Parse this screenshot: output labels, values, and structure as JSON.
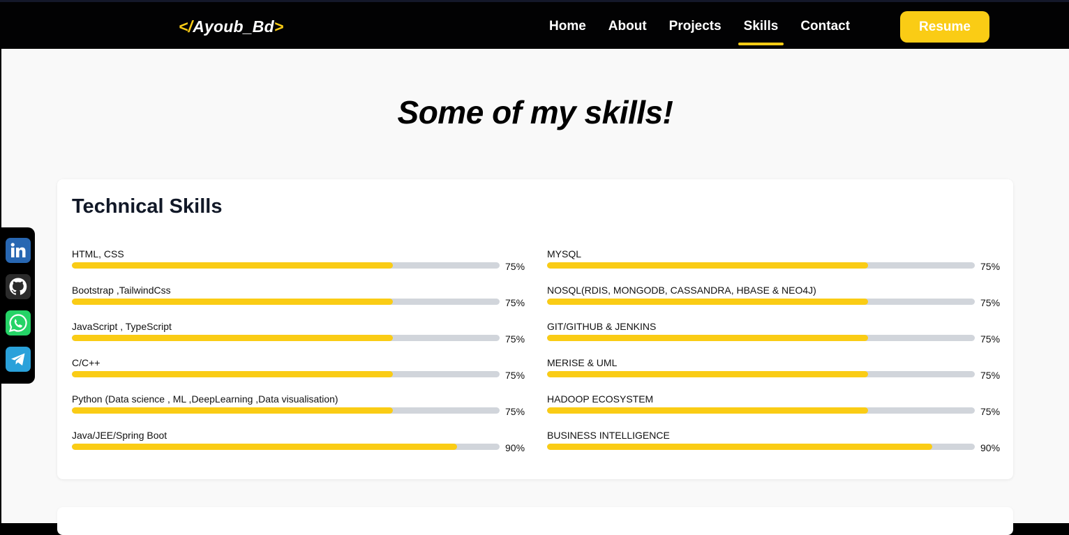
{
  "nav": {
    "logo_open": "</",
    "logo_name": "Ayoub_Bd",
    "logo_close": ">",
    "links": [
      "Home",
      "About",
      "Projects",
      "Skills",
      "Contact"
    ],
    "active": "Skills",
    "resume_label": "Resume"
  },
  "page": {
    "title": "Some of my skills!"
  },
  "technical": {
    "title": "Technical Skills",
    "left": [
      {
        "label": "HTML, CSS",
        "percent": 75,
        "percent_label": "75%"
      },
      {
        "label": "Bootstrap ,TailwindCss",
        "percent": 75,
        "percent_label": "75%"
      },
      {
        "label": "JavaScript , TypeScript",
        "percent": 75,
        "percent_label": "75%"
      },
      {
        "label": "C/C++",
        "percent": 75,
        "percent_label": "75%"
      },
      {
        "label": "Python (Data science , ML ,DeepLearning ,Data visualisation)",
        "percent": 75,
        "percent_label": "75%"
      },
      {
        "label": "Java/JEE/Spring Boot",
        "percent": 90,
        "percent_label": "90%"
      }
    ],
    "right": [
      {
        "label": "MYSQL",
        "percent": 75,
        "percent_label": "75%"
      },
      {
        "label": "NOSQL(RDIS, MONGODB, CASSANDRA, HBASE & NEO4J)",
        "percent": 75,
        "percent_label": "75%"
      },
      {
        "label": "GIT/GITHUB & JENKINS",
        "percent": 75,
        "percent_label": "75%"
      },
      {
        "label": "MERISE & UML",
        "percent": 75,
        "percent_label": "75%"
      },
      {
        "label": "HADOOP ECOSYSTEM",
        "percent": 75,
        "percent_label": "75%"
      },
      {
        "label": "BUSINESS INTELLIGENCE",
        "percent": 90,
        "percent_label": "90%"
      }
    ]
  },
  "social": [
    {
      "icon": "linkedin-icon",
      "color": "#2867b2"
    },
    {
      "icon": "github-icon",
      "color": "#2b2b2b"
    },
    {
      "icon": "whatsapp-icon",
      "color": "#25d366"
    },
    {
      "icon": "telegram-icon",
      "color": "#2aa1da"
    }
  ],
  "colors": {
    "accent": "#facc15",
    "navbar": "#020203",
    "track": "#d1d5db"
  }
}
